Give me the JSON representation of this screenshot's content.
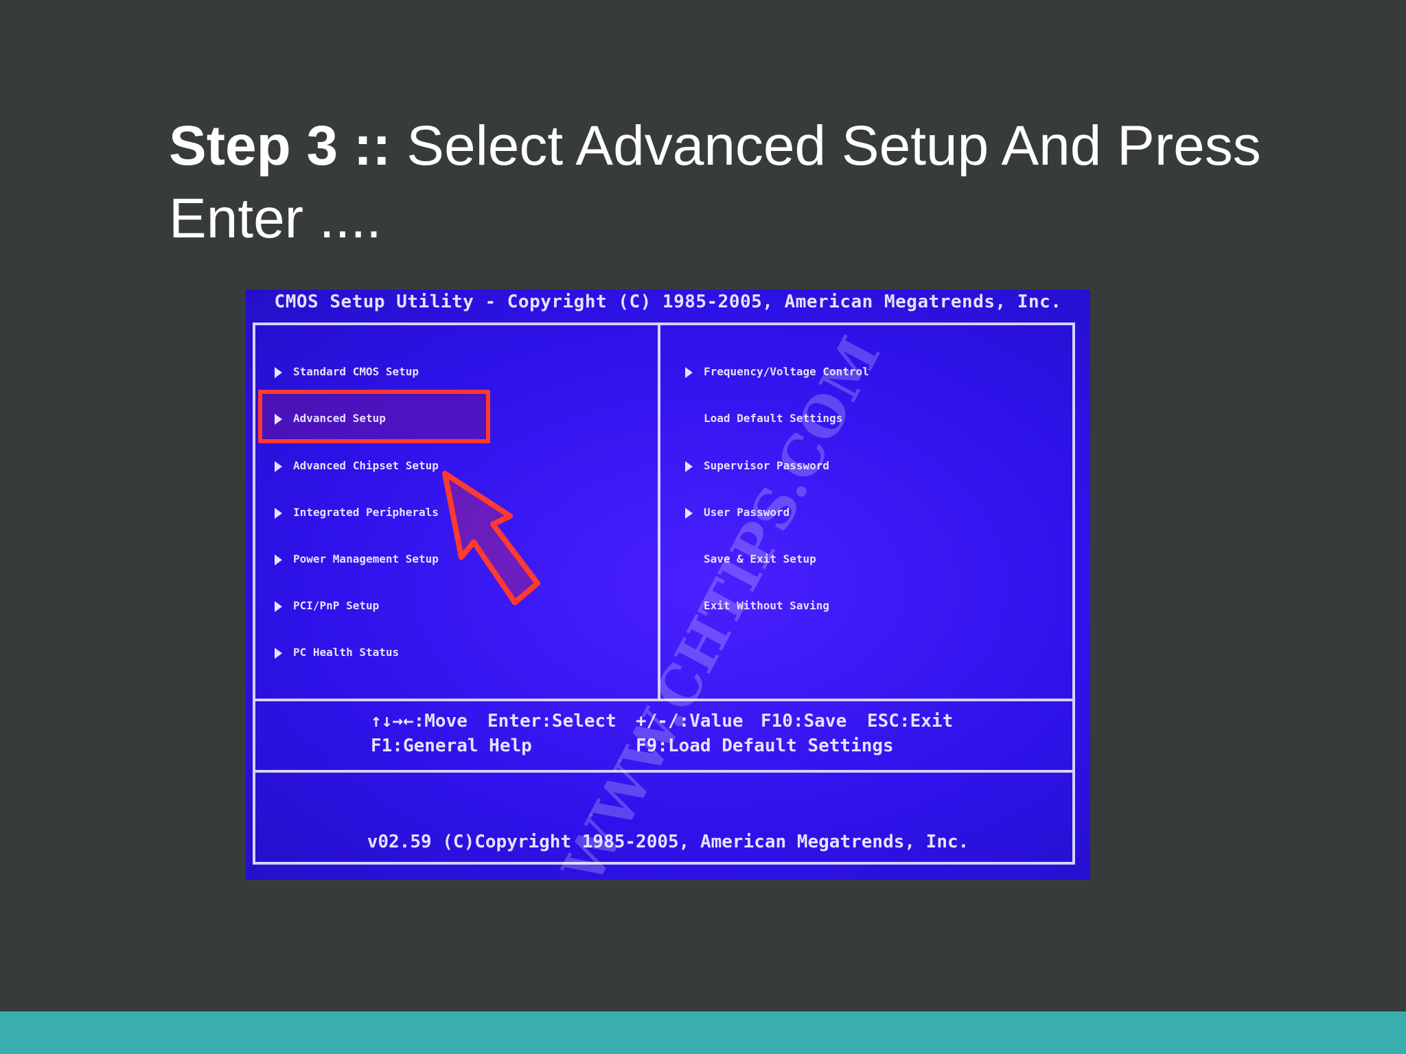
{
  "slide": {
    "title_bold": "Step 3 ::",
    "title_rest": " Select Advanced Setup And Press Enter ....",
    "bottom_bar_color": "#3aaeae",
    "background_color": "#373b3c"
  },
  "bios": {
    "header": "CMOS Setup Utility - Copyright (C) 1985-2005, American Megatrends, Inc.",
    "left_menu": [
      {
        "label": "Standard CMOS Setup",
        "arrow": true
      },
      {
        "label": "Advanced Setup",
        "arrow": true,
        "selected": true
      },
      {
        "label": "Advanced Chipset Setup",
        "arrow": true
      },
      {
        "label": "Integrated Peripherals",
        "arrow": true
      },
      {
        "label": "Power Management Setup",
        "arrow": true
      },
      {
        "label": "PCI/PnP Setup",
        "arrow": true
      },
      {
        "label": "PC Health Status",
        "arrow": true
      }
    ],
    "right_menu": [
      {
        "label": "Frequency/Voltage Control",
        "arrow": true
      },
      {
        "label": "Load Default Settings",
        "arrow": false
      },
      {
        "label": "Supervisor Password",
        "arrow": true
      },
      {
        "label": "User Password",
        "arrow": true
      },
      {
        "label": "Save & Exit Setup",
        "arrow": false
      },
      {
        "label": "Exit Without Saving",
        "arrow": false
      }
    ],
    "help": {
      "move": "↑↓→←:Move",
      "select": "Enter:Select",
      "value": "+/-/:Value",
      "save": "F10:Save",
      "exit": "ESC:Exit",
      "general_help": "F1:General Help",
      "load_defaults": "F9:Load Default Settings"
    },
    "footer": "v02.59 (C)Copyright 1985-2005, American Megatrends, Inc.",
    "watermark": "WWW.CHTIPS.COM",
    "background_color": "#2a10e8",
    "highlight_color": "#ff3b2e"
  }
}
